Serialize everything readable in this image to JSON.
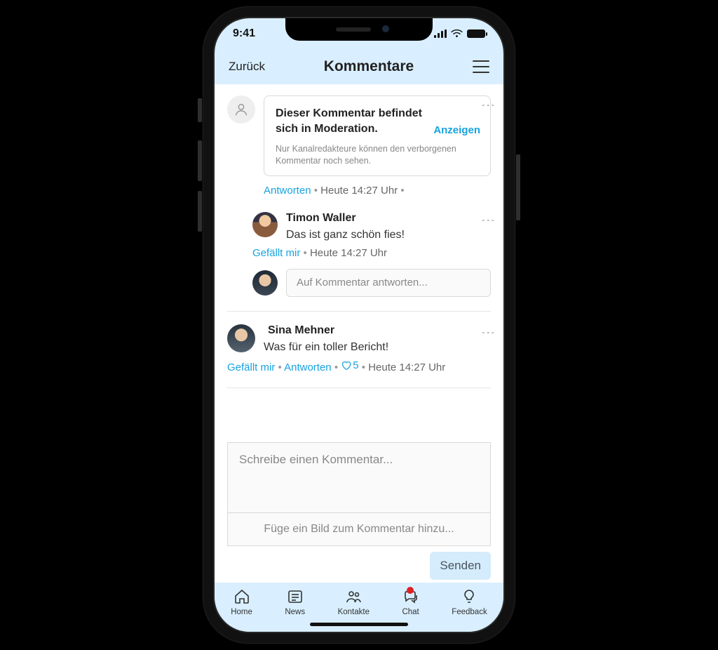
{
  "status": {
    "time": "9:41"
  },
  "header": {
    "back": "Zurück",
    "title": "Kommentare"
  },
  "moderated": {
    "title_line1": "Dieser Kommentar befindet",
    "title_line2": "sich in Moderation.",
    "show": "Anzeigen",
    "sub": "Nur Kanalredakteure können den verborgenen Kommentar noch sehen.",
    "reply": "Antworten",
    "time": "Heute 14:27 Uhr"
  },
  "reply1": {
    "name": "Timon Waller",
    "body": "Das ist ganz schön fies!",
    "like": "Gefällt mir",
    "time": "Heute 14:27 Uhr",
    "placeholder": "Auf Kommentar antworten..."
  },
  "thread2": {
    "name": "Sina Mehner",
    "body": "Was für ein toller Bericht!",
    "like": "Gefällt mir",
    "reply": "Antworten",
    "likes": "5",
    "time": "Heute 14:27 Uhr"
  },
  "composer": {
    "placeholder": "Schreibe einen Kommentar...",
    "image": "Füge ein Bild zum Kommentar hinzu...",
    "send": "Senden"
  },
  "tabs": {
    "home": "Home",
    "news": "News",
    "contacts": "Kontakte",
    "chat": "Chat",
    "feedback": "Feedback"
  }
}
